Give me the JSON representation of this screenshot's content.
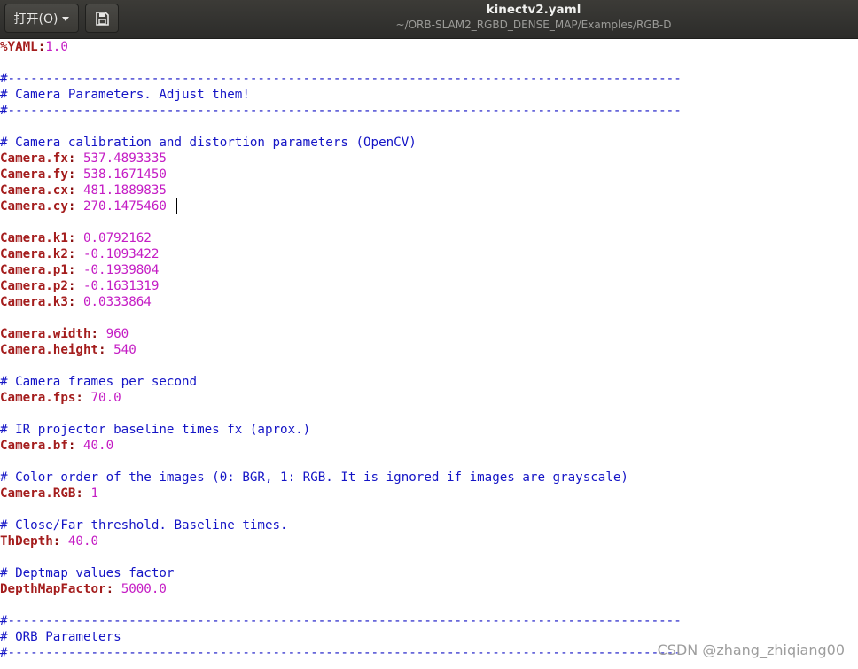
{
  "window": {
    "open_label": "打开(O)",
    "title": "kinectv2.yaml",
    "subtitle": "~/ORB-SLAM2_RGBD_DENSE_MAP/Examples/RGB-D"
  },
  "icons": {
    "open_menu": "chevron-down-icon",
    "save": "save-icon"
  },
  "colors": {
    "comment": "#1515c6",
    "key": "#a41d1d",
    "value": "#c41cc4"
  },
  "code": {
    "l1": {
      "key": "%YAML",
      "value": "1.0"
    },
    "l2": "#-----------------------------------------------------------------------------------------",
    "l3": "# Camera Parameters. Adjust them!",
    "l4": "#-----------------------------------------------------------------------------------------",
    "l5": "# Camera calibration and distortion parameters (OpenCV)",
    "l6": {
      "key": "Camera.fx",
      "value": "537.4893335"
    },
    "l7": {
      "key": "Camera.fy",
      "value": "538.1671450"
    },
    "l8": {
      "key": "Camera.cx",
      "value": "481.1889835"
    },
    "l9": {
      "key": "Camera.cy",
      "value": "270.1475460"
    },
    "l10": {
      "key": "Camera.k1",
      "value": "0.0792162"
    },
    "l11": {
      "key": "Camera.k2",
      "value": "-0.1093422"
    },
    "l12": {
      "key": "Camera.p1",
      "value": "-0.1939804"
    },
    "l13": {
      "key": "Camera.p2",
      "value": "-0.1631319"
    },
    "l14": {
      "key": "Camera.k3",
      "value": "0.0333864"
    },
    "l15": {
      "key": "Camera.width",
      "value": "960"
    },
    "l16": {
      "key": "Camera.height",
      "value": "540"
    },
    "l17": "# Camera frames per second",
    "l18": {
      "key": "Camera.fps",
      "value": "70.0"
    },
    "l19": "# IR projector baseline times fx (aprox.)",
    "l20": {
      "key": "Camera.bf",
      "value": "40.0"
    },
    "l21": "# Color order of the images (0: BGR, 1: RGB. It is ignored if images are grayscale)",
    "l22": {
      "key": "Camera.RGB",
      "value": "1"
    },
    "l23": "# Close/Far threshold. Baseline times.",
    "l24": {
      "key": "ThDepth",
      "value": "40.0"
    },
    "l25": "# Deptmap values factor",
    "l26": {
      "key": "DepthMapFactor",
      "value": "5000.0"
    },
    "l27": "#-----------------------------------------------------------------------------------------",
    "l28": "# ORB Parameters",
    "l29": "#-----------------------------------------------------------------------------------------"
  },
  "watermark": "CSDN @zhang_zhiqiang00"
}
